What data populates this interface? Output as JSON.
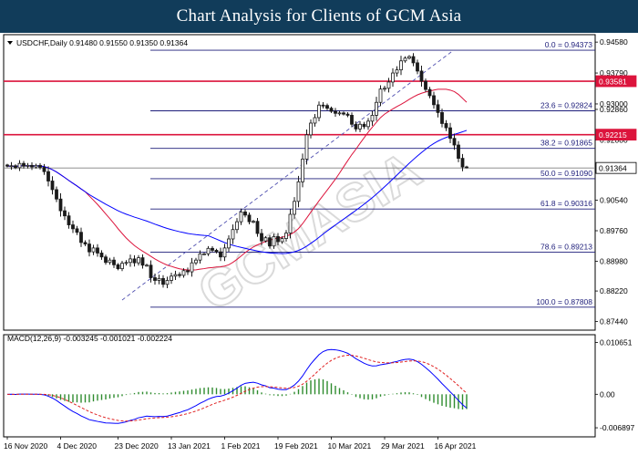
{
  "header": {
    "title": "Chart Analysis for Clients of GCM Asia"
  },
  "colors": {
    "header_bg": "#113c5a",
    "candle": "#1a1a1a",
    "price_line": "#808080",
    "ma_fast": "#dc143c",
    "ma_slow": "#0000ff",
    "fib_line": "#1d1d7a",
    "resistance": "#dc143c",
    "price_label_bg": "#dc143c",
    "trend_line": "#5050b0",
    "macd_line": "#0000ff",
    "signal_line": "#e02020",
    "histogram": "#2e8b2e"
  },
  "chart_data": [
    {
      "type": "candlestick",
      "header": "USDCHF,Daily  0.91480 0.91550 0.91350 0.91364",
      "y_range": [
        0.8722,
        0.9477
      ],
      "y_ticks": [
        "0.94580",
        "0.93790",
        "0.93000",
        "0.92860",
        "0.92080",
        "0.91364",
        "0.90540",
        "0.89760",
        "0.88980",
        "0.88220",
        "0.87440"
      ],
      "x_ticks": [
        "16 Nov 2020",
        "4 Dec 2020",
        "23 Dec 2020",
        "13 Jan 2021",
        "1 Feb 2021",
        "19 Feb 2021",
        "10 Mar 2021",
        "29 Mar 2021",
        "16 Apr 2021"
      ],
      "fib_levels": [
        {
          "label": "0.0 = 0.94373",
          "value": 0.94373
        },
        {
          "label": "23.6 = 0.92824",
          "value": 0.92824
        },
        {
          "label": "38.2 = 0.91865",
          "value": 0.91865
        },
        {
          "label": "50.0 = 0.91090",
          "value": 0.9109
        },
        {
          "label": "61.8 = 0.90316",
          "value": 0.90316
        },
        {
          "label": "78.6 = 0.89213",
          "value": 0.89213
        },
        {
          "label": "100.0 = 0.87808",
          "value": 0.87808
        }
      ],
      "resistance_levels": [
        {
          "label": "0.93581",
          "value": 0.93581
        },
        {
          "label": "0.92215",
          "value": 0.92215
        }
      ],
      "current_price": {
        "label": "0.91364",
        "value": 0.91364
      },
      "trend_line": {
        "from": [
          28,
          0.8799
        ],
        "to": [
          107,
          0.9437
        ]
      },
      "closes": [
        0.9141,
        0.9142,
        0.9137,
        0.9148,
        0.9141,
        0.9143,
        0.9139,
        0.9143,
        0.9138,
        0.9127,
        0.9103,
        0.9081,
        0.9057,
        0.9027,
        0.9014,
        0.8991,
        0.8981,
        0.8972,
        0.8946,
        0.8942,
        0.8922,
        0.8932,
        0.8919,
        0.8909,
        0.8895,
        0.8901,
        0.8889,
        0.8879,
        0.8893,
        0.8895,
        0.8904,
        0.8894,
        0.8907,
        0.8888,
        0.8888,
        0.8856,
        0.8849,
        0.8854,
        0.8839,
        0.8849,
        0.886,
        0.8864,
        0.8862,
        0.8874,
        0.8871,
        0.8894,
        0.8901,
        0.8917,
        0.8917,
        0.8931,
        0.8926,
        0.8922,
        0.8909,
        0.8932,
        0.8955,
        0.8979,
        0.8999,
        0.9024,
        0.9016,
        0.8999,
        0.9,
        0.8969,
        0.895,
        0.8958,
        0.8937,
        0.8961,
        0.8948,
        0.8956,
        0.897,
        0.9018,
        0.9051,
        0.9101,
        0.9159,
        0.9221,
        0.9251,
        0.9265,
        0.9297,
        0.9296,
        0.9289,
        0.9281,
        0.9276,
        0.9277,
        0.9274,
        0.9271,
        0.9248,
        0.9236,
        0.9248,
        0.9242,
        0.9256,
        0.9271,
        0.9304,
        0.9338,
        0.934,
        0.9356,
        0.9379,
        0.9387,
        0.941,
        0.9417,
        0.9421,
        0.9405,
        0.9384,
        0.9358,
        0.9337,
        0.9321,
        0.9298,
        0.9278,
        0.925,
        0.9239,
        0.9212,
        0.9195,
        0.9161,
        0.9139,
        0.9138
      ],
      "ma_fast_period": 20,
      "ma_slow_period": 50
    },
    {
      "type": "line",
      "header": "MACD(12,26,9) -0.003245 -0.001021 -0.002224",
      "y_ticks": [
        "0.010651",
        "0.00",
        "-0.006897"
      ],
      "y_range": [
        -0.0082,
        0.0117
      ],
      "series": [
        {
          "name": "MACD",
          "type": "line"
        },
        {
          "name": "Signal",
          "type": "line"
        },
        {
          "name": "Histogram",
          "type": "bar"
        }
      ]
    }
  ]
}
